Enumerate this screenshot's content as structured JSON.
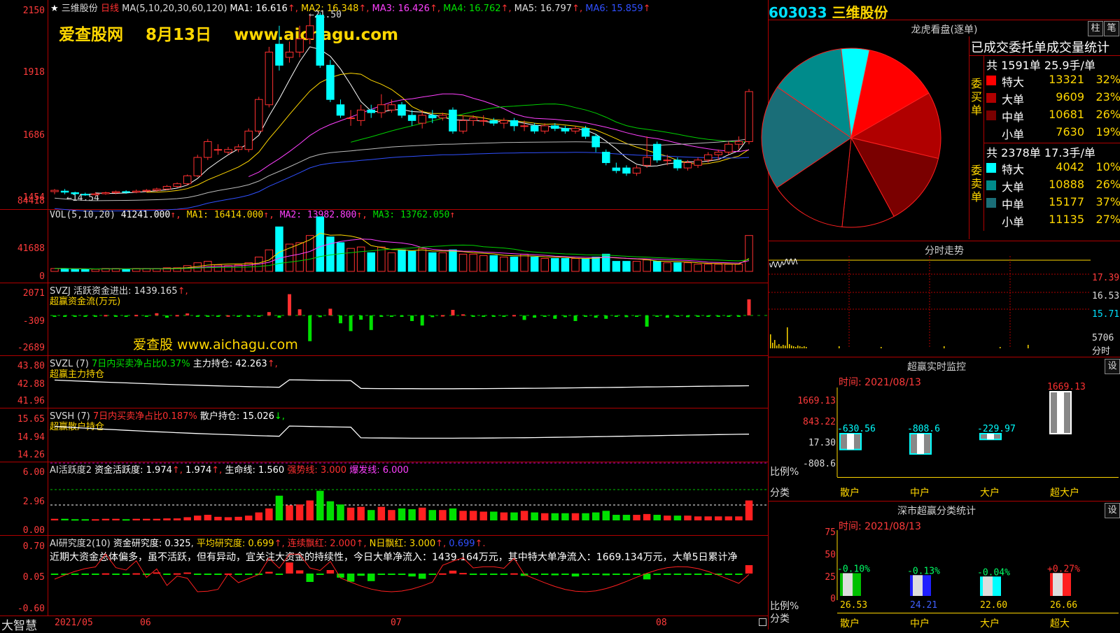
{
  "stock": {
    "code": "603033",
    "name": "三维股份"
  },
  "header": {
    "star": "★",
    "stock_name": "三维股份",
    "period": "日线",
    "ma_label": "MA(5,10,20,30,60,120)",
    "ma1": "MA1: 16.616",
    "ma2": "MA2: 16.348",
    "ma3": "MA3: 16.426",
    "ma4": "MA4: 16.762",
    "ma5": "MA5: 16.797",
    "ma6": "MA6: 15.859",
    "high_mark": "21.50",
    "low_mark": "14.54"
  },
  "watermark": {
    "top": "爱查股网    8月13日    www.aichagu.com",
    "mid": "爱查股 www.aichagu.com"
  },
  "price_axis": [
    "2150",
    "1918",
    "1686",
    "1454"
  ],
  "vol": {
    "axis": [
      "84418",
      "41688",
      "0"
    ],
    "label": "VOL(5,10,20)",
    "value": "41241.000",
    "ma1": "MA1: 16414.000",
    "ma2": "MA2: 13982.800",
    "ma3": "MA3: 13762.050"
  },
  "svzj": {
    "axis": [
      "2071",
      "-309",
      "-2689"
    ],
    "label": "SVZJ  活跃资金进出: 1439.165",
    "sub": "超赢资金流(万元)"
  },
  "svzl": {
    "axis": [
      "43.80",
      "42.88",
      "41.96"
    ],
    "label": "SVZL  (7)",
    "pct": "7日内买卖净占比0.37%",
    "hold": "主力持仓: 42.263",
    "sub": "超赢主力持仓"
  },
  "svsh": {
    "axis": [
      "15.65",
      "14.94",
      "14.26"
    ],
    "label": "SVSH  (7)",
    "pct": "7日内买卖净占比0.187%",
    "hold": "散户持仓: 15.026",
    "sub": "超赢散户持仓"
  },
  "ai1": {
    "axis": [
      "6.00",
      "2.96",
      "0.00"
    ],
    "label": "AI活跃度2",
    "act": "资金活跃度: 1.974",
    "act2": "1.974",
    "life": "生命线: 1.560",
    "strong": "强势线: 3.000",
    "burst": "爆发线: 6.000"
  },
  "ai2": {
    "axis": [
      "0.70",
      "0.05",
      "-0.60"
    ],
    "label": "AI研究度2(10)",
    "res": "资金研究度: 0.325",
    "avg": "平均研究度: 0.699",
    "cont": "连续飘红: 2.000",
    "nday": "N日飘红: 3.000",
    "last": "0.699",
    "comment": "近期大资金总体偏多，虽不活跃，但有异动，宜关注大资金的持续性，今日大单净流入：1439.164万元，其中特大单净流入：1669.134万元，大单5日累计净"
  },
  "bottom_bar": {
    "brand": "大智慧",
    "dates": [
      "2021/05",
      "06",
      "07",
      "08"
    ]
  },
  "longhu": {
    "title": "龙虎看盘(逐单)",
    "btn_bar": "柱",
    "btn_pen": "笔",
    "header": "已成交委托单成交量统计",
    "buy": {
      "side": "委买单",
      "total": "共 1591单 25.9手/单",
      "rows": [
        {
          "name": "特大",
          "vol": "13321",
          "pct": "32%",
          "color": "#ff0000"
        },
        {
          "name": "大单",
          "vol": "9609",
          "pct": "23%",
          "color": "#b00000"
        },
        {
          "name": "中单",
          "vol": "10681",
          "pct": "26%",
          "color": "#7a0000"
        },
        {
          "name": "小单",
          "vol": "7630",
          "pct": "19%",
          "color": "#000000"
        }
      ]
    },
    "sell": {
      "side": "委卖单",
      "total": "共 2378单 17.3手/单",
      "rows": [
        {
          "name": "特大",
          "vol": "4042",
          "pct": "10%",
          "color": "#00ffff"
        },
        {
          "name": "大单",
          "vol": "10888",
          "pct": "26%",
          "color": "#008b8b"
        },
        {
          "name": "中单",
          "vol": "15177",
          "pct": "37%",
          "color": "#1a6e78"
        },
        {
          "name": "小单",
          "vol": "11135",
          "pct": "27%",
          "color": "#000000"
        }
      ]
    }
  },
  "intraday": {
    "title": "分时走势",
    "axis": [
      "17.39",
      "16.53",
      "15.71",
      "5706"
    ],
    "unit": "分时"
  },
  "monitor": {
    "title": "超赢实时监控",
    "btn": "设",
    "time": "时间: 2021/08/13",
    "axis": [
      "1669.13",
      "843.22",
      "17.30",
      "-808.6"
    ],
    "row_ratio": "比例%",
    "row_cat": "分类",
    "bars": [
      {
        "label": "-630.56",
        "cat": "散户",
        "value": -630.56
      },
      {
        "label": "-808.6",
        "cat": "中户",
        "value": -808.6
      },
      {
        "label": "-229.97",
        "cat": "大户",
        "value": -229.97
      },
      {
        "label": "1669.13",
        "cat": "超大户",
        "value": 1669.13
      }
    ]
  },
  "sz_stats": {
    "title": "深市超赢分类统计",
    "btn": "设",
    "time": "时间: 2021/08/13",
    "axis": [
      "75",
      "50",
      "25",
      "0"
    ],
    "row_ratio": "比例%",
    "row_cat": "分类",
    "bars": [
      {
        "top": "-0.10%",
        "pct": "26.53",
        "cat": "散户",
        "value": 26.53
      },
      {
        "top": "-0.13%",
        "pct": "24.21",
        "cat": "中户",
        "value": 24.21
      },
      {
        "top": "-0.04%",
        "pct": "22.60",
        "cat": "大户",
        "value": 22.6
      },
      {
        "top": "+0.27%",
        "pct": "26.66",
        "cat": "超大",
        "value": 26.66
      }
    ]
  },
  "chart_data": {
    "type": "candlestick",
    "price_range": [
      14.54,
      21.5
    ],
    "candles": [
      [
        14.7,
        14.75,
        14.6,
        14.8
      ],
      [
        14.72,
        14.68,
        14.6,
        14.8
      ],
      [
        14.66,
        14.62,
        14.55,
        14.7
      ],
      [
        14.6,
        14.58,
        14.54,
        14.66
      ],
      [
        14.58,
        14.62,
        14.55,
        14.68
      ],
      [
        14.62,
        14.66,
        14.58,
        14.7
      ],
      [
        14.66,
        14.7,
        14.6,
        14.74
      ],
      [
        14.7,
        14.68,
        14.62,
        14.75
      ],
      [
        14.68,
        14.72,
        14.64,
        14.78
      ],
      [
        14.72,
        14.75,
        14.68,
        14.8
      ],
      [
        14.75,
        14.8,
        14.7,
        14.85
      ],
      [
        14.8,
        14.9,
        14.76,
        14.95
      ],
      [
        14.9,
        15.0,
        14.85,
        15.05
      ],
      [
        15.0,
        15.3,
        14.95,
        15.35
      ],
      [
        15.3,
        16.0,
        15.25,
        16.1
      ],
      [
        16.0,
        16.6,
        15.9,
        16.7
      ],
      [
        16.3,
        16.3,
        16.1,
        16.5
      ],
      [
        16.2,
        16.3,
        16.1,
        16.4
      ],
      [
        16.3,
        16.4,
        16.2,
        16.5
      ],
      [
        16.3,
        17.0,
        16.2,
        17.1
      ],
      [
        17.0,
        18.2,
        16.9,
        18.3
      ],
      [
        18.0,
        20.0,
        17.9,
        20.2
      ],
      [
        20.3,
        19.5,
        19.3,
        21.0
      ],
      [
        19.8,
        20.0,
        19.6,
        20.4
      ],
      [
        20.0,
        20.5,
        19.8,
        21.0
      ],
      [
        20.5,
        21.0,
        20.3,
        21.4
      ],
      [
        21.4,
        19.5,
        19.4,
        21.5
      ],
      [
        19.5,
        18.2,
        18.1,
        19.7
      ],
      [
        18.0,
        17.6,
        17.5,
        18.2
      ],
      [
        17.5,
        17.5,
        17.2,
        17.8
      ],
      [
        17.4,
        17.8,
        17.2,
        18.0
      ],
      [
        17.8,
        17.7,
        17.5,
        18.0
      ],
      [
        17.7,
        18.0,
        17.5,
        18.4
      ],
      [
        17.8,
        18.0,
        17.7,
        18.2
      ],
      [
        18.0,
        17.6,
        17.5,
        18.1
      ],
      [
        17.6,
        17.4,
        17.2,
        17.8
      ],
      [
        17.3,
        17.6,
        17.1,
        17.8
      ],
      [
        17.6,
        17.5,
        17.3,
        17.8
      ],
      [
        17.5,
        17.6,
        17.4,
        17.7
      ],
      [
        17.8,
        17.0,
        16.9,
        17.9
      ],
      [
        17.0,
        17.4,
        16.9,
        17.6
      ],
      [
        17.4,
        17.5,
        17.2,
        17.6
      ],
      [
        17.4,
        17.4,
        17.2,
        17.6
      ],
      [
        17.4,
        17.3,
        17.2,
        17.5
      ],
      [
        17.3,
        17.4,
        17.1,
        17.5
      ],
      [
        17.4,
        17.2,
        17.0,
        17.5
      ],
      [
        17.2,
        17.2,
        17.0,
        17.4
      ],
      [
        17.2,
        17.0,
        16.9,
        17.3
      ],
      [
        17.0,
        17.2,
        16.9,
        17.3
      ],
      [
        17.2,
        17.1,
        17.0,
        17.3
      ],
      [
        17.1,
        17.0,
        16.9,
        17.2
      ],
      [
        17.0,
        17.1,
        16.9,
        17.2
      ],
      [
        17.1,
        16.8,
        16.7,
        17.2
      ],
      [
        16.8,
        16.4,
        16.2,
        16.9
      ],
      [
        16.2,
        15.8,
        15.7,
        16.3
      ],
      [
        15.6,
        15.5,
        15.4,
        15.8
      ],
      [
        15.6,
        15.4,
        15.3,
        15.7
      ],
      [
        15.4,
        15.6,
        15.3,
        15.7
      ],
      [
        15.7,
        16.0,
        15.6,
        16.8
      ],
      [
        16.5,
        15.9,
        15.8,
        16.6
      ],
      [
        15.9,
        15.9,
        15.7,
        16.1
      ],
      [
        15.9,
        15.6,
        15.5,
        16.0
      ],
      [
        15.6,
        15.8,
        15.5,
        15.9
      ],
      [
        15.7,
        15.9,
        15.6,
        16.0
      ],
      [
        15.9,
        16.1,
        15.8,
        16.2
      ],
      [
        16.1,
        16.2,
        15.9,
        16.3
      ],
      [
        16.2,
        16.5,
        16.1,
        16.6
      ],
      [
        16.5,
        16.6,
        16.3,
        16.8
      ],
      [
        16.6,
        18.5,
        16.5,
        18.6
      ]
    ],
    "volumes": [
      4,
      4,
      3,
      3,
      3,
      4,
      4,
      3,
      4,
      4,
      4,
      5,
      5,
      8,
      12,
      14,
      9,
      8,
      9,
      12,
      20,
      30,
      62,
      38,
      40,
      50,
      76,
      48,
      40,
      32,
      34,
      26,
      34,
      26,
      30,
      28,
      32,
      26,
      26,
      30,
      24,
      24,
      22,
      22,
      20,
      20,
      24,
      20,
      18,
      18,
      18,
      18,
      18,
      20,
      24,
      14,
      14,
      14,
      16,
      14,
      12,
      12,
      12,
      10,
      10,
      10,
      10,
      10,
      50
    ],
    "svzj": [
      -80,
      -40,
      -30,
      -50,
      -10,
      40,
      -30,
      -20,
      50,
      -60,
      200,
      -200,
      40,
      180,
      -80,
      -30,
      -50,
      10,
      -40,
      -30,
      -50,
      300,
      -200,
      1900,
      550,
      -2300,
      -150,
      600,
      -700,
      -1400,
      -380,
      -1300,
      -50,
      -100,
      -60,
      -500,
      -900,
      -150,
      30,
      500,
      100,
      -80,
      -50,
      -40,
      -60,
      40,
      -400,
      -200,
      -80,
      -300,
      -150,
      -500,
      -100,
      -200,
      -300,
      -50,
      -150,
      -90,
      -1000,
      -110,
      -200,
      -80,
      -150,
      -90,
      -100,
      -80,
      -90,
      -60,
      1439
    ]
  }
}
